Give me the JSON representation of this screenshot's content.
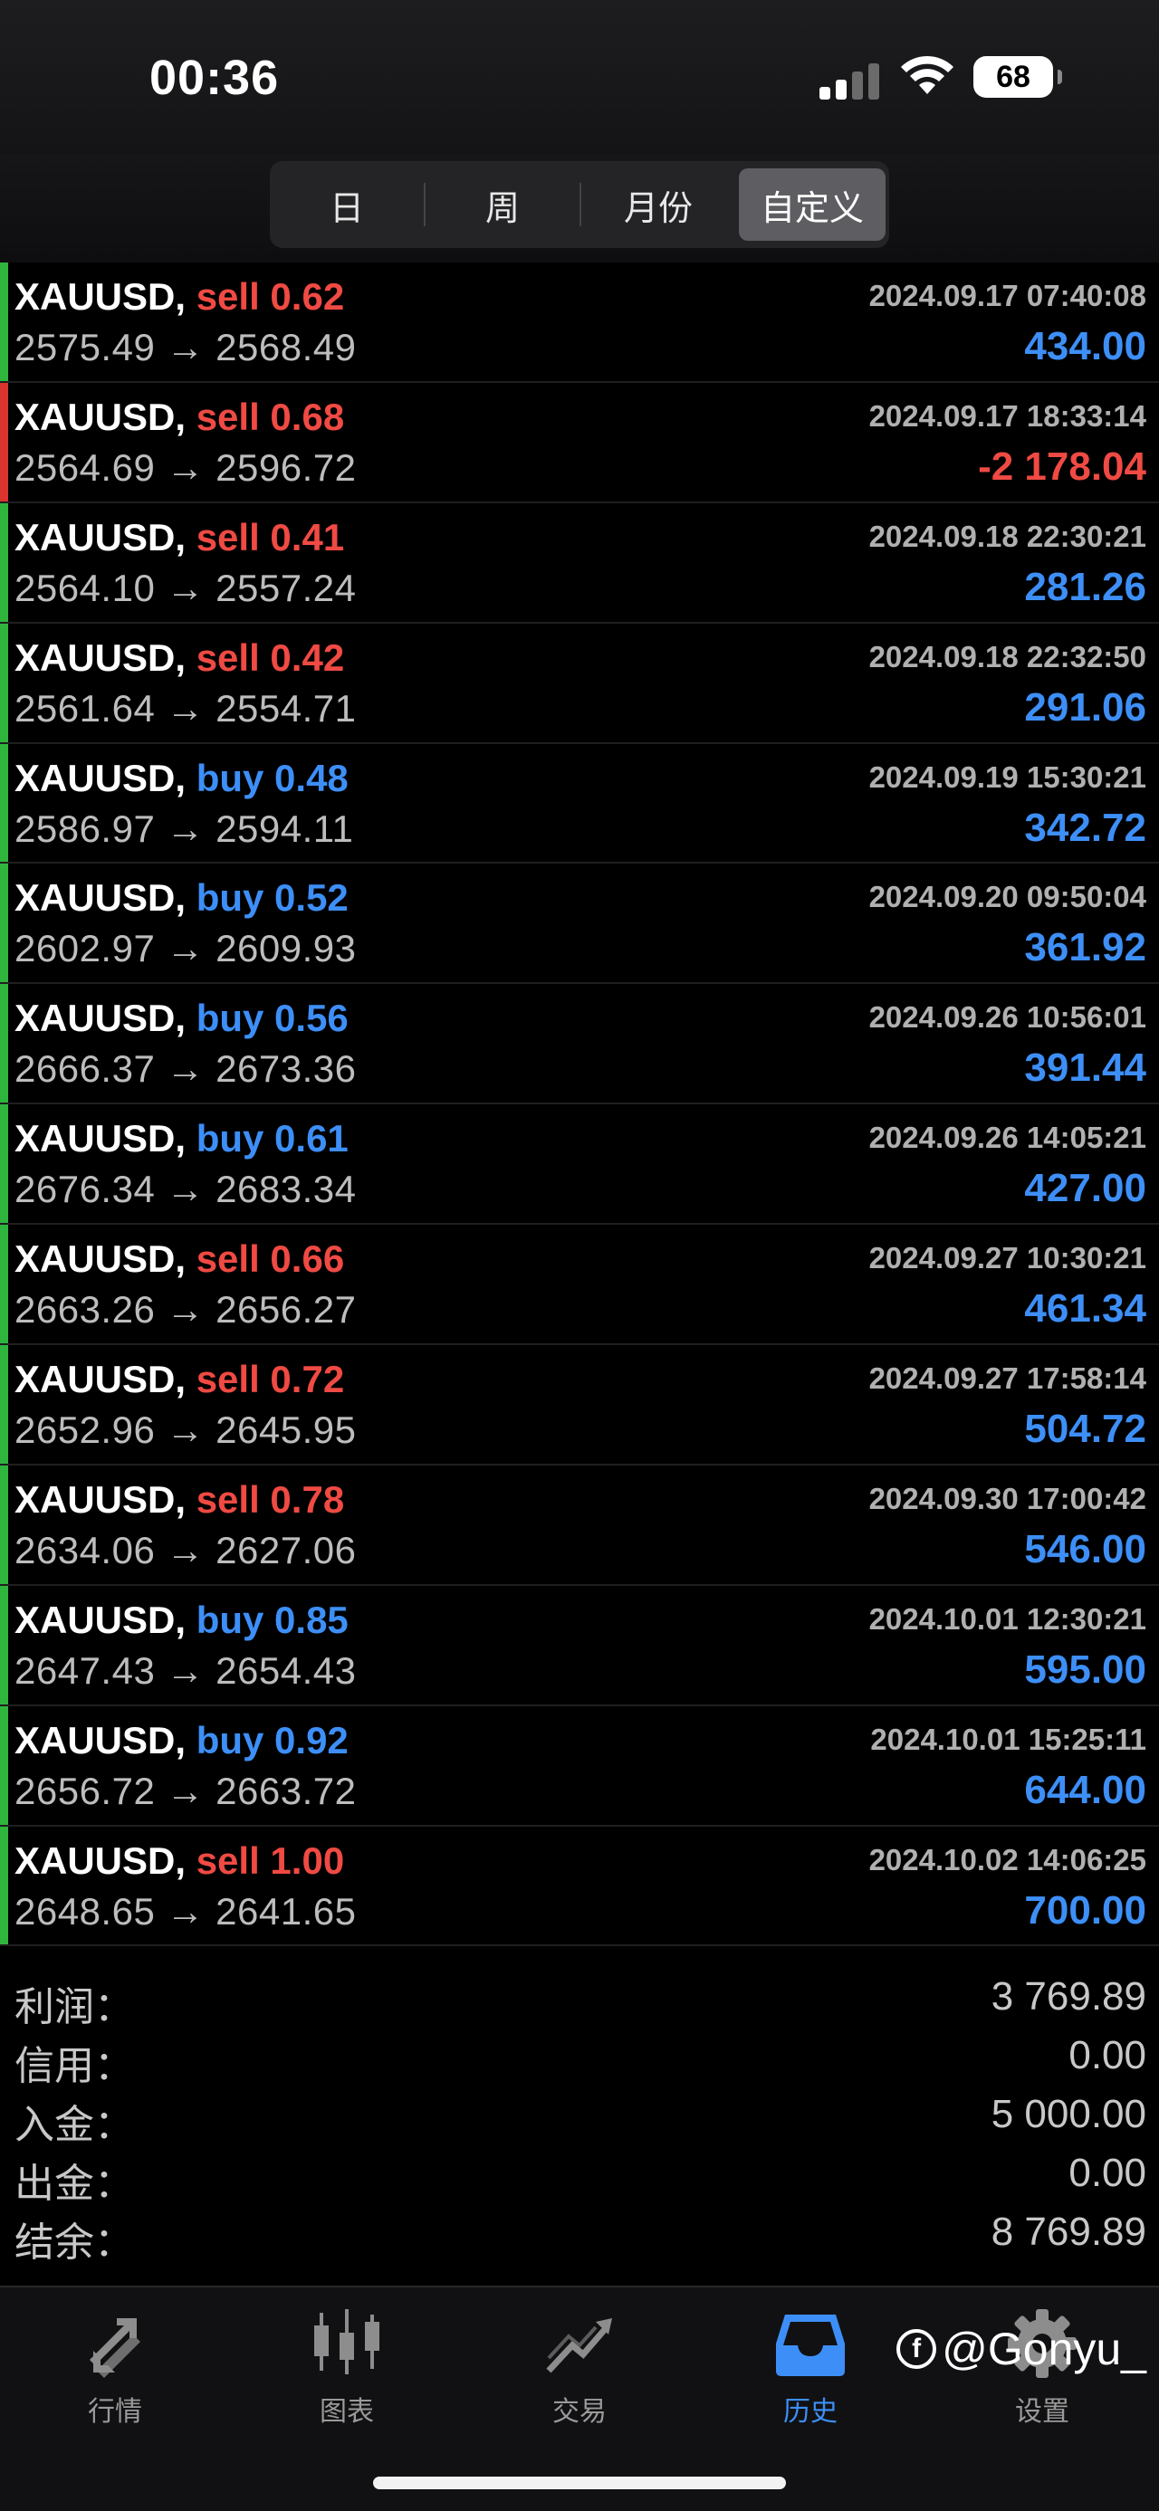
{
  "status_bar": {
    "time": "00:36",
    "battery": "68"
  },
  "segments": [
    {
      "label": "日",
      "active": false
    },
    {
      "label": "周",
      "active": false
    },
    {
      "label": "月份",
      "active": false
    },
    {
      "label": "自定义",
      "active": true
    }
  ],
  "colors": {
    "profit": "#3d8ff7",
    "loss": "#ef4a43",
    "sell": "#ef4a43",
    "buy": "#3d8ff7",
    "win_bar": "#2fb53d",
    "loss_bar": "#d9342e"
  },
  "trades": [
    {
      "symbol": "XAUUSD,",
      "side_volume": "sell 0.62",
      "side": "sell",
      "prices": "2575.49 → 2568.49",
      "time": "2024.09.17 07:40:08",
      "profit": "434.00",
      "loss": false
    },
    {
      "symbol": "XAUUSD,",
      "side_volume": "sell 0.68",
      "side": "sell",
      "prices": "2564.69 → 2596.72",
      "time": "2024.09.17 18:33:14",
      "profit": "-2 178.04",
      "loss": true
    },
    {
      "symbol": "XAUUSD,",
      "side_volume": "sell 0.41",
      "side": "sell",
      "prices": "2564.10 → 2557.24",
      "time": "2024.09.18 22:30:21",
      "profit": "281.26",
      "loss": false
    },
    {
      "symbol": "XAUUSD,",
      "side_volume": "sell 0.42",
      "side": "sell",
      "prices": "2561.64 → 2554.71",
      "time": "2024.09.18 22:32:50",
      "profit": "291.06",
      "loss": false
    },
    {
      "symbol": "XAUUSD,",
      "side_volume": "buy 0.48",
      "side": "buy",
      "prices": "2586.97 → 2594.11",
      "time": "2024.09.19 15:30:21",
      "profit": "342.72",
      "loss": false
    },
    {
      "symbol": "XAUUSD,",
      "side_volume": "buy 0.52",
      "side": "buy",
      "prices": "2602.97 → 2609.93",
      "time": "2024.09.20 09:50:04",
      "profit": "361.92",
      "loss": false
    },
    {
      "symbol": "XAUUSD,",
      "side_volume": "buy 0.56",
      "side": "buy",
      "prices": "2666.37 → 2673.36",
      "time": "2024.09.26 10:56:01",
      "profit": "391.44",
      "loss": false
    },
    {
      "symbol": "XAUUSD,",
      "side_volume": "buy 0.61",
      "side": "buy",
      "prices": "2676.34 → 2683.34",
      "time": "2024.09.26 14:05:21",
      "profit": "427.00",
      "loss": false
    },
    {
      "symbol": "XAUUSD,",
      "side_volume": "sell 0.66",
      "side": "sell",
      "prices": "2663.26 → 2656.27",
      "time": "2024.09.27 10:30:21",
      "profit": "461.34",
      "loss": false
    },
    {
      "symbol": "XAUUSD,",
      "side_volume": "sell 0.72",
      "side": "sell",
      "prices": "2652.96 → 2645.95",
      "time": "2024.09.27 17:58:14",
      "profit": "504.72",
      "loss": false
    },
    {
      "symbol": "XAUUSD,",
      "side_volume": "sell 0.78",
      "side": "sell",
      "prices": "2634.06 → 2627.06",
      "time": "2024.09.30 17:00:42",
      "profit": "546.00",
      "loss": false
    },
    {
      "symbol": "XAUUSD,",
      "side_volume": "buy 0.85",
      "side": "buy",
      "prices": "2647.43 → 2654.43",
      "time": "2024.10.01 12:30:21",
      "profit": "595.00",
      "loss": false
    },
    {
      "symbol": "XAUUSD,",
      "side_volume": "buy 0.92",
      "side": "buy",
      "prices": "2656.72 → 2663.72",
      "time": "2024.10.01 15:25:11",
      "profit": "644.00",
      "loss": false
    },
    {
      "symbol": "XAUUSD,",
      "side_volume": "sell 1.00",
      "side": "sell",
      "prices": "2648.65 → 2641.65",
      "time": "2024.10.02 14:06:25",
      "profit": "700.00",
      "loss": false
    }
  ],
  "summary": [
    {
      "label": "利润：",
      "value": "3 769.89"
    },
    {
      "label": "信用：",
      "value": "0.00"
    },
    {
      "label": "入金：",
      "value": "5 000.00"
    },
    {
      "label": "出金：",
      "value": "0.00"
    },
    {
      "label": "结余：",
      "value": "8 769.89"
    }
  ],
  "tabs": [
    {
      "label": "行情",
      "icon": "quotes-arrows-icon",
      "active": false
    },
    {
      "label": "图表",
      "icon": "candlestick-chart-icon",
      "active": false
    },
    {
      "label": "交易",
      "icon": "trade-line-icon",
      "active": false
    },
    {
      "label": "历史",
      "icon": "history-inbox-icon",
      "active": true
    },
    {
      "label": "设置",
      "icon": "gear-icon",
      "active": false
    }
  ],
  "watermark": "@Gonyu_"
}
